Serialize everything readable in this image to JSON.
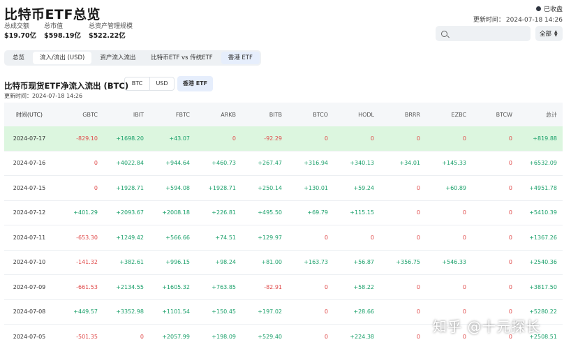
{
  "page": {
    "title": "比特币ETF总览",
    "market_status": "已收盘",
    "update_label": "更新时间：",
    "update_time": "2024-07-18 14:26"
  },
  "stats": [
    {
      "label": "总成交额",
      "value": "$19.70亿"
    },
    {
      "label": "总市值",
      "value": "$598.19亿"
    },
    {
      "label": "总资产管理规模",
      "value": "$522.22亿"
    }
  ],
  "search": {
    "placeholder": "",
    "value": ""
  },
  "filter": {
    "selected": "全部"
  },
  "tabs": [
    "总览",
    "流入/流出 (USD)",
    "资产流入流出",
    "比特币ETF vs 传统ETF",
    "香港 ETF"
  ],
  "section": {
    "title": "比特币现货ETF净流入流出 (BTC)",
    "units": [
      "BTC",
      "USD"
    ],
    "hk_button": "香港 ETF",
    "update_text": "更新时间：2024-07-18 14:26"
  },
  "table": {
    "columns": [
      "时间(UTC)",
      "GBTC",
      "IBIT",
      "FBTC",
      "ARKB",
      "BITB",
      "BTCO",
      "HODL",
      "BRRR",
      "EZBC",
      "BTCW",
      "总计"
    ],
    "rows": [
      [
        "2024-07-17",
        "-829.10",
        "+1698.20",
        "+43.07",
        "0",
        "-92.29",
        "0",
        "0",
        "0",
        "0",
        "0",
        "+819.88"
      ],
      [
        "2024-07-16",
        "0",
        "+4022.84",
        "+944.64",
        "+460.73",
        "+267.47",
        "+316.94",
        "+340.13",
        "+34.01",
        "+145.33",
        "0",
        "+6532.09"
      ],
      [
        "2024-07-15",
        "0",
        "+1928.71",
        "+594.08",
        "+1928.71",
        "+250.14",
        "+130.01",
        "+59.24",
        "0",
        "+60.89",
        "0",
        "+4951.78"
      ],
      [
        "2024-07-12",
        "+401.29",
        "+2093.67",
        "+2008.18",
        "+226.81",
        "+495.50",
        "+69.79",
        "+115.15",
        "0",
        "0",
        "0",
        "+5410.39"
      ],
      [
        "2024-07-11",
        "-653.30",
        "+1249.42",
        "+566.66",
        "+74.51",
        "+129.97",
        "0",
        "0",
        "0",
        "0",
        "0",
        "+1367.26"
      ],
      [
        "2024-07-10",
        "-141.32",
        "+382.61",
        "+996.15",
        "+98.24",
        "+81.00",
        "+163.73",
        "+56.87",
        "+356.75",
        "+546.33",
        "0",
        "+2540.36"
      ],
      [
        "2024-07-09",
        "-661.53",
        "+2134.55",
        "+1605.32",
        "+763.85",
        "-82.91",
        "0",
        "+58.22",
        "0",
        "0",
        "0",
        "+3817.50"
      ],
      [
        "2024-07-08",
        "+449.57",
        "+3352.98",
        "+1101.54",
        "+150.45",
        "+197.02",
        "0",
        "+28.66",
        "0",
        "0",
        "0",
        "+5280.22"
      ],
      [
        "2024-07-05",
        "-501.35",
        "0",
        "+2057.99",
        "+198.09",
        "+529.40",
        "0",
        "+224.38",
        "0",
        "0",
        "0",
        "+2508.51"
      ]
    ]
  },
  "watermark": "知乎 @十元探长",
  "colors": {
    "positive": "#1aa06a",
    "negative": "#e04a4a",
    "highlight_row": "#dcf6df",
    "accent": "#e6eefc"
  }
}
